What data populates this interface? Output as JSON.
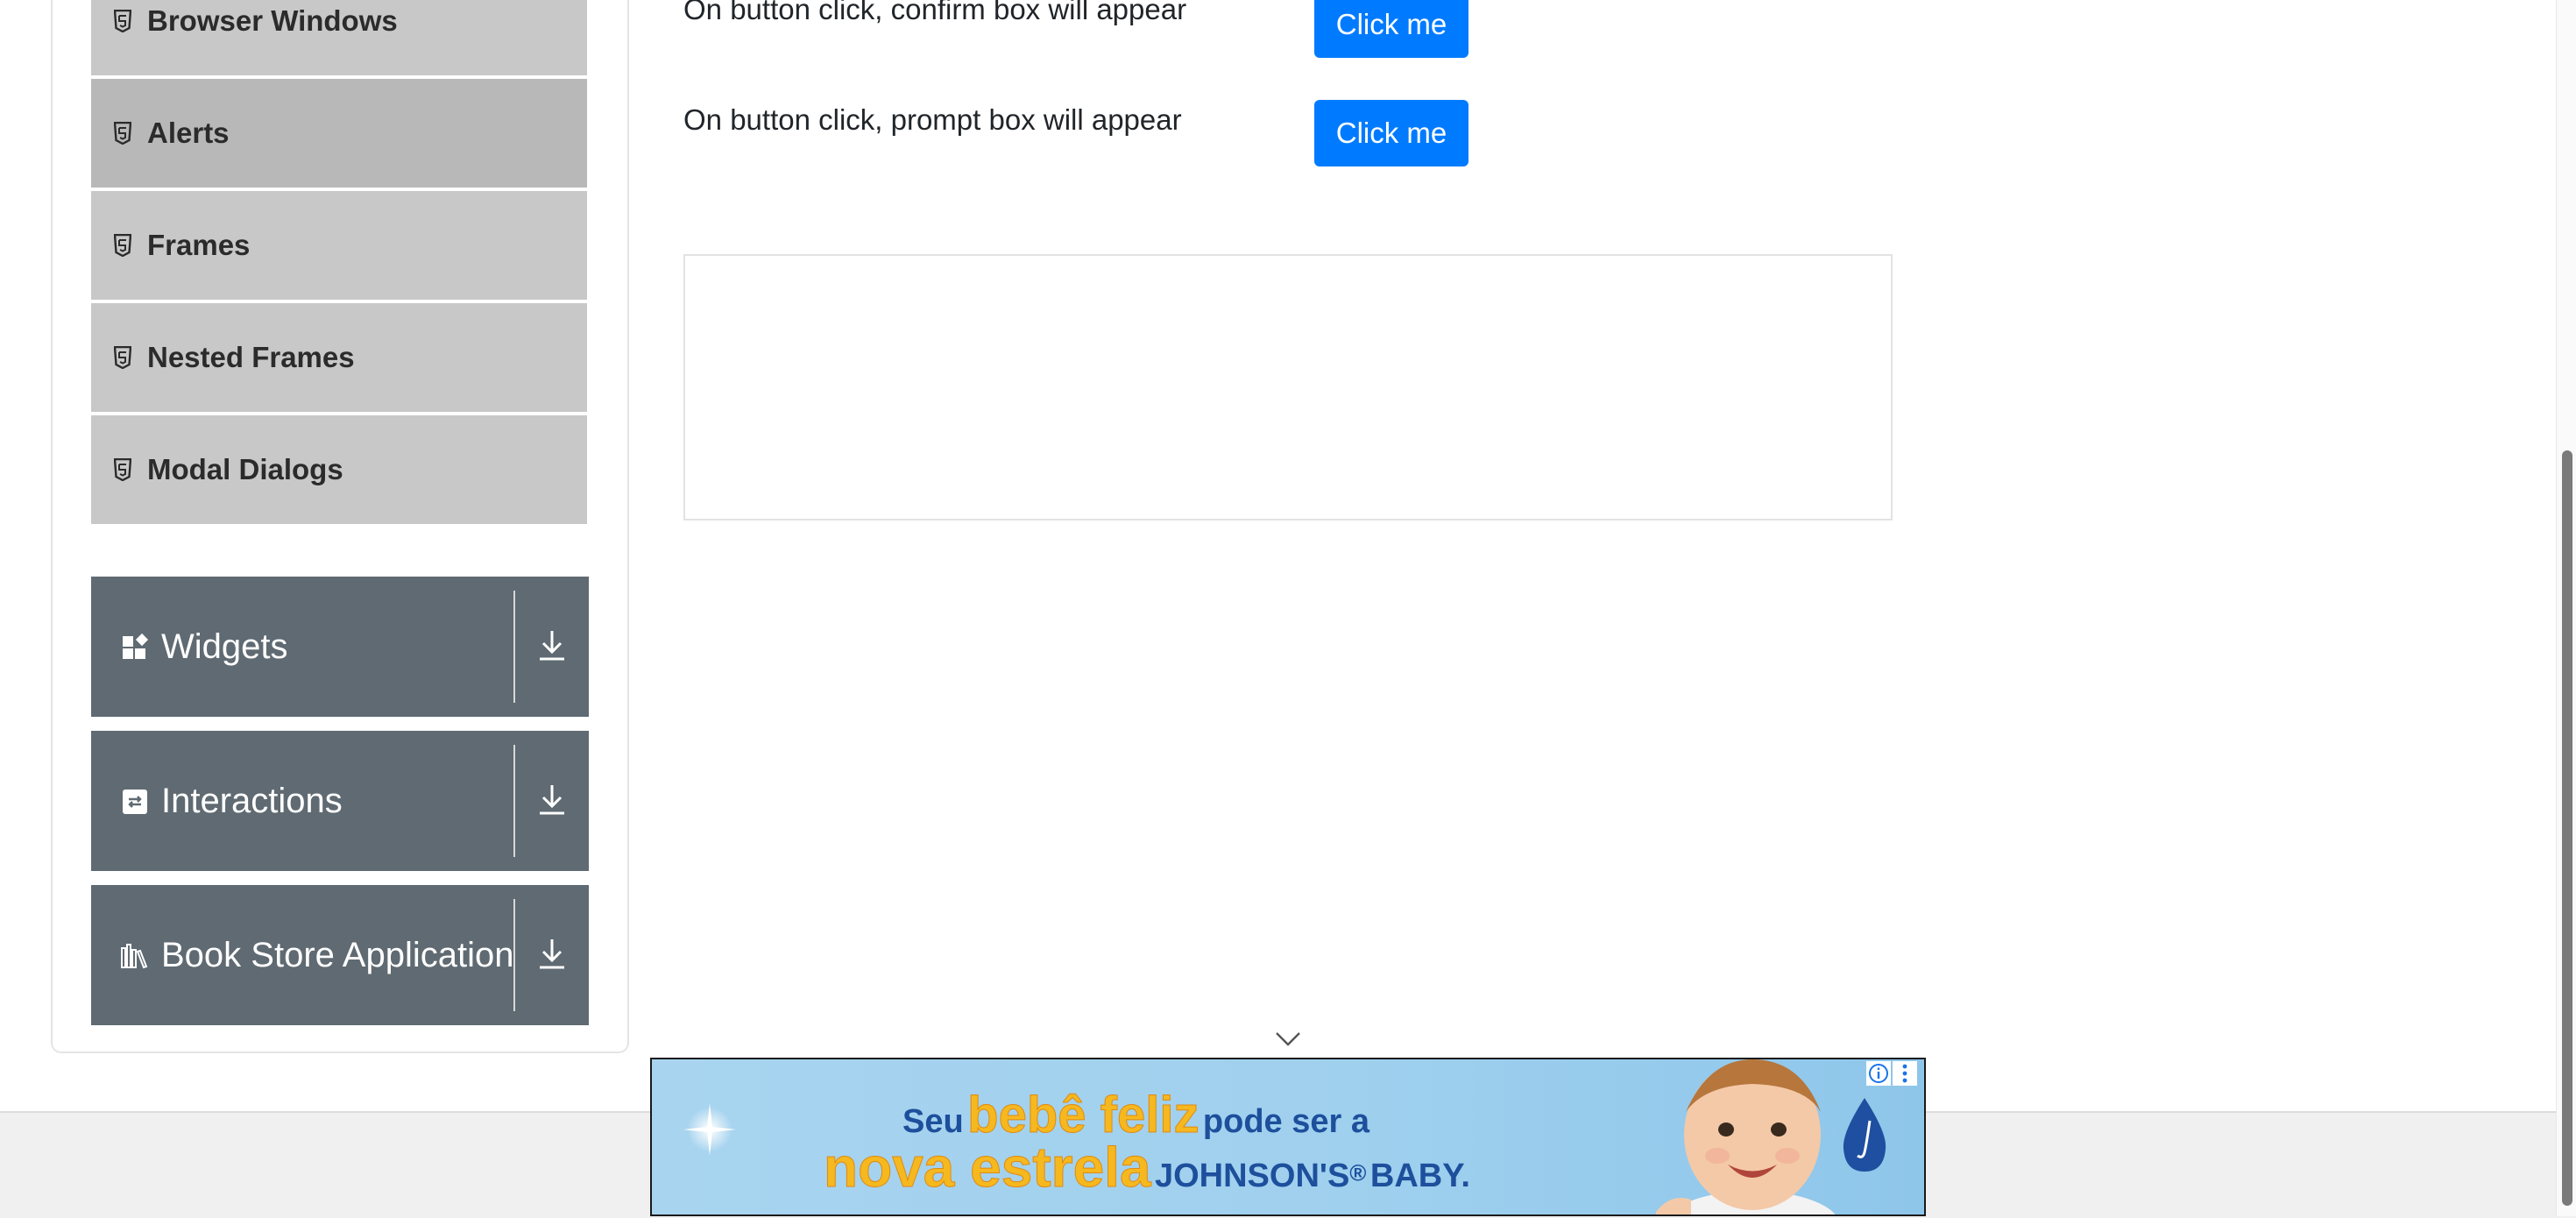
{
  "sidebar": {
    "alerts_frames_items": [
      {
        "label": "Browser Windows",
        "icon": "html5-icon"
      },
      {
        "label": "Alerts",
        "icon": "html5-icon",
        "active": true
      },
      {
        "label": "Frames",
        "icon": "html5-icon"
      },
      {
        "label": "Nested Frames",
        "icon": "html5-icon"
      },
      {
        "label": "Modal Dialogs",
        "icon": "html5-icon"
      }
    ],
    "groups": [
      {
        "label": "Widgets",
        "icon": "widgets-icon"
      },
      {
        "label": "Interactions",
        "icon": "interactions-icon"
      },
      {
        "label": "Book Store Application",
        "icon": "book-store-icon"
      }
    ]
  },
  "main": {
    "rows": [
      {
        "text": "On button click, confirm box will appear",
        "button_label": "Click me"
      },
      {
        "text": "On button click, prompt box will appear",
        "button_label": "Click me"
      }
    ]
  },
  "ad": {
    "line1_a": "Seu",
    "line1_b": "bebê feliz",
    "line1_c": "pode ser a",
    "line2_a": "nova estrela",
    "line2_b": "JOHNSON'S",
    "line2_reg": "®",
    "line2_c": "BABY."
  },
  "colors": {
    "primary_button": "#007bff",
    "group_header": "#5f6a72",
    "submenu_bg": "#c8c8c8",
    "submenu_active_bg": "#b8b8b8"
  }
}
